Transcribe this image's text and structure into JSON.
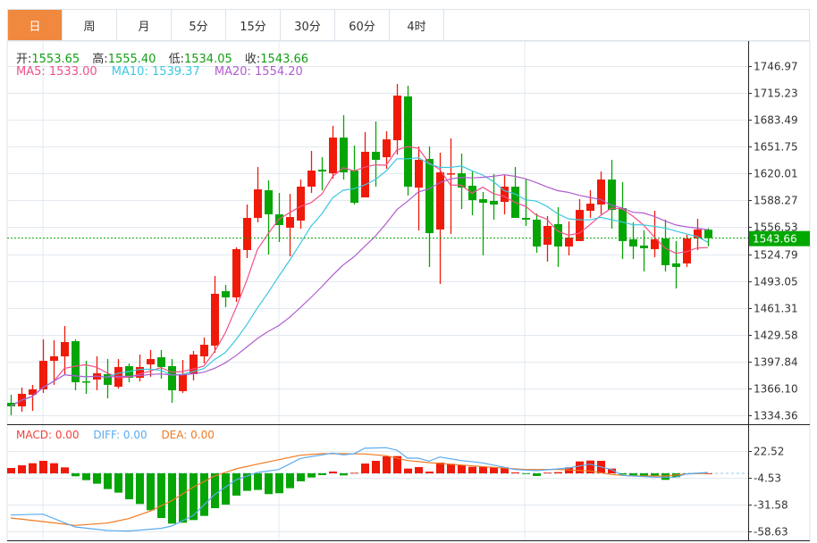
{
  "tabs": [
    "日",
    "周",
    "月",
    "5分",
    "15分",
    "30分",
    "60分",
    "4时",
    ""
  ],
  "active_tab": 0,
  "ohlc_info": {
    "open_label": "开:",
    "open": "1553.65",
    "high_label": "高:",
    "high": "1555.40",
    "low_label": "低:",
    "low": "1534.05",
    "close_label": "收:",
    "close": "1543.66"
  },
  "ma_info": {
    "ma5": "MA5: 1533.00",
    "ma10": "MA10: 1539.37",
    "ma20": "MA20: 1554.20"
  },
  "macd_info": {
    "macd": "MACD: 0.00",
    "diff": "DIFF: 0.00",
    "dea": "DEA: 0.00"
  },
  "colors": {
    "up": "#f01a0a",
    "down": "#06a506",
    "ma5": "#f0508a",
    "ma10": "#3cc8e0",
    "ma20": "#b05ccf",
    "diff": "#5aabf0",
    "dea": "#f07a22",
    "active_tab": "#f0883e",
    "last_price": "#00a800"
  },
  "chart_data": [
    {
      "type": "candlestick",
      "price_ticks": [
        "1746.97",
        "1715.23",
        "1683.49",
        "1651.75",
        "1620.01",
        "1588.27",
        "1556.53",
        "1524.79",
        "1493.05",
        "1461.31",
        "1429.58",
        "1397.84",
        "1366.10",
        "1334.36"
      ],
      "ylim": [
        1334.36,
        1746.97
      ],
      "grid": true,
      "last_price": "1543.66",
      "ohlc": [
        [
          1349.1,
          1358.6,
          1334.4,
          1344.9
        ],
        [
          1344.9,
          1367.1,
          1338.6,
          1359.7
        ],
        [
          1358.6,
          1370.3,
          1339.6,
          1365.0
        ],
        [
          1365.0,
          1424.0,
          1360.8,
          1398.7
        ],
        [
          1398.7,
          1423.0,
          1370.3,
          1404.0
        ],
        [
          1404.0,
          1439.9,
          1382.9,
          1420.9
        ],
        [
          1421.9,
          1424.0,
          1363.9,
          1373.4
        ],
        [
          1374.5,
          1398.7,
          1359.7,
          1373.4
        ],
        [
          1376.6,
          1404.0,
          1363.9,
          1384.0
        ],
        [
          1382.9,
          1400.8,
          1354.4,
          1370.3
        ],
        [
          1368.1,
          1400.8,
          1366.0,
          1391.4
        ],
        [
          1392.4,
          1395.6,
          1373.4,
          1378.7
        ],
        [
          1378.7,
          1406.1,
          1374.5,
          1391.4
        ],
        [
          1394.5,
          1411.4,
          1379.8,
          1400.8
        ],
        [
          1402.9,
          1411.4,
          1377.7,
          1391.4
        ],
        [
          1392.4,
          1400.8,
          1349.1,
          1363.9
        ],
        [
          1362.9,
          1399.8,
          1360.8,
          1382.9
        ],
        [
          1382.9,
          1410.3,
          1375.6,
          1406.1
        ],
        [
          1404.0,
          1426.2,
          1395.6,
          1417.7
        ],
        [
          1416.7,
          1499.0,
          1408.2,
          1477.9
        ],
        [
          1481.0,
          1488.4,
          1462.1,
          1473.7
        ],
        [
          1473.7,
          1532.8,
          1468.4,
          1530.7
        ],
        [
          1529.6,
          1583.4,
          1520.1,
          1567.6
        ],
        [
          1567.6,
          1627.7,
          1562.3,
          1601.3
        ],
        [
          1600.3,
          1611.9,
          1524.3,
          1571.8
        ],
        [
          1571.8,
          1597.1,
          1539.1,
          1559.1
        ],
        [
          1556.0,
          1596.0,
          1522.2,
          1568.6
        ],
        [
          1564.4,
          1612.9,
          1554.9,
          1604.5
        ],
        [
          1604.5,
          1646.7,
          1597.1,
          1623.5
        ],
        [
          1624.6,
          1639.3,
          1600.3,
          1622.4
        ],
        [
          1620.3,
          1676.3,
          1614.0,
          1662.5
        ],
        [
          1662.5,
          1688.9,
          1612.9,
          1621.4
        ],
        [
          1623.5,
          1653.0,
          1583.4,
          1585.5
        ],
        [
          1591.8,
          1668.9,
          1591.8,
          1645.7
        ],
        [
          1645.7,
          1681.5,
          1604.5,
          1636.2
        ],
        [
          1639.3,
          1669.9,
          1625.6,
          1660.4
        ],
        [
          1659.4,
          1725.9,
          1642.5,
          1712.1
        ],
        [
          1711.1,
          1723.8,
          1593.9,
          1604.5
        ],
        [
          1603.4,
          1652.0,
          1552.8,
          1636.2
        ],
        [
          1637.2,
          1652.0,
          1509.6,
          1549.6
        ],
        [
          1553.9,
          1644.6,
          1489.5,
          1621.4
        ],
        [
          1619.3,
          1661.5,
          1548.6,
          1620.3
        ],
        [
          1620.3,
          1643.5,
          1578.1,
          1603.4
        ],
        [
          1605.6,
          1622.4,
          1570.7,
          1588.6
        ],
        [
          1589.7,
          1598.2,
          1523.3,
          1585.5
        ],
        [
          1587.6,
          1619.3,
          1565.5,
          1583.4
        ],
        [
          1586.5,
          1618.2,
          1571.8,
          1604.5
        ],
        [
          1604.5,
          1627.7,
          1567.6,
          1567.6
        ],
        [
          1567.6,
          1612.9,
          1558.1,
          1565.5
        ],
        [
          1565.5,
          1572.8,
          1526.4,
          1533.8
        ],
        [
          1535.9,
          1569.7,
          1515.9,
          1558.1
        ],
        [
          1560.2,
          1580.2,
          1509.6,
          1533.8
        ],
        [
          1533.8,
          1563.4,
          1523.3,
          1544.4
        ],
        [
          1540.2,
          1589.7,
          1540.2,
          1577.0
        ],
        [
          1576.0,
          1600.3,
          1567.6,
          1584.4
        ],
        [
          1583.4,
          1622.4,
          1571.8,
          1612.9
        ],
        [
          1612.9,
          1636.2,
          1554.9,
          1577.0
        ],
        [
          1579.2,
          1609.8,
          1519.0,
          1540.2
        ],
        [
          1542.3,
          1562.3,
          1519.0,
          1533.8
        ],
        [
          1534.9,
          1552.8,
          1504.3,
          1531.7
        ],
        [
          1530.7,
          1576.0,
          1521.2,
          1542.3
        ],
        [
          1543.3,
          1565.5,
          1504.3,
          1511.7
        ],
        [
          1513.8,
          1540.2,
          1484.2,
          1509.6
        ],
        [
          1513.8,
          1547.6,
          1509.6,
          1543.3
        ],
        [
          1543.3,
          1566.5,
          1529.6,
          1553.9
        ],
        [
          1553.65,
          1555.4,
          1534.05,
          1543.66
        ]
      ],
      "ma_periods": [
        5,
        10,
        20
      ]
    },
    {
      "type": "bar+line",
      "macd_ticks": [
        "22.52",
        "-4.53",
        "-31.58",
        "-58.63"
      ],
      "ylim": [
        -58.63,
        22.52
      ],
      "histogram": [
        5.4,
        8.1,
        10.2,
        12.6,
        10.2,
        6.0,
        -3.0,
        -6.9,
        -10.5,
        -15.9,
        -19.5,
        -26.2,
        -31.0,
        -37.3,
        -45.1,
        -50.8,
        -49.9,
        -47.2,
        -43.0,
        -35.2,
        -31.6,
        -22.5,
        -17.7,
        -16.8,
        -21.0,
        -20.1,
        -15.0,
        -8.1,
        -4.2,
        -1.8,
        1.8,
        -2.1,
        0.5,
        9.9,
        12.6,
        17.1,
        17.4,
        4.8,
        6.3,
        1.8,
        10.8,
        9.6,
        8.1,
        6.6,
        6.6,
        6.0,
        6.0,
        0.9,
        -0.3,
        -2.7,
        0.6,
        1.2,
        6.0,
        12.0,
        12.9,
        12.6,
        4.8,
        -1.2,
        -2.1,
        -3.0,
        -3.0,
        -6.6,
        -3.9,
        -0.3,
        0.3,
        0.0
      ],
      "diff": [
        [
          0,
          -42.1
        ],
        [
          3,
          -41.2
        ],
        [
          6,
          -54.1
        ],
        [
          9,
          -57.7
        ],
        [
          11,
          -58.3
        ],
        [
          14,
          -55.6
        ],
        [
          15,
          -53.2
        ],
        [
          17,
          -42.7
        ],
        [
          19,
          -21.6
        ],
        [
          21,
          -6.6
        ],
        [
          23,
          0.9
        ],
        [
          25,
          3.9
        ],
        [
          27,
          15.0
        ],
        [
          30,
          20.4
        ],
        [
          31,
          18.6
        ],
        [
          32,
          19.8
        ],
        [
          33,
          25.3
        ],
        [
          35,
          25.9
        ],
        [
          36,
          23.4
        ],
        [
          37,
          15.3
        ],
        [
          38,
          15.3
        ],
        [
          39,
          12.3
        ],
        [
          40,
          16.5
        ],
        [
          42,
          12.9
        ],
        [
          44,
          10.5
        ],
        [
          47,
          3.9
        ],
        [
          49,
          2.7
        ],
        [
          52,
          5.4
        ],
        [
          54,
          9.3
        ],
        [
          56,
          3.9
        ],
        [
          57,
          -2.1
        ],
        [
          60,
          -3.9
        ],
        [
          62,
          -3.9
        ],
        [
          63,
          -0.6
        ],
        [
          65,
          0.9
        ]
      ],
      "dea": [
        [
          0,
          -45.1
        ],
        [
          3,
          -48.7
        ],
        [
          6,
          -52.6
        ],
        [
          9,
          -50.2
        ],
        [
          11,
          -45.7
        ],
        [
          13,
          -38.2
        ],
        [
          15,
          -27.7
        ],
        [
          17,
          -14.1
        ],
        [
          19,
          -2.7
        ],
        [
          21,
          4.5
        ],
        [
          23,
          9.3
        ],
        [
          25,
          13.8
        ],
        [
          27,
          18.3
        ],
        [
          29,
          19.8
        ],
        [
          31,
          19.8
        ],
        [
          33,
          19.5
        ],
        [
          35,
          17.7
        ],
        [
          37,
          12.9
        ],
        [
          39,
          10.8
        ],
        [
          42,
          8.4
        ],
        [
          45,
          6.0
        ],
        [
          48,
          3.9
        ],
        [
          51,
          3.9
        ],
        [
          54,
          2.4
        ],
        [
          56,
          -1.2
        ],
        [
          58,
          -2.7
        ],
        [
          61,
          -2.7
        ],
        [
          63,
          -0.6
        ],
        [
          65,
          0.0
        ]
      ]
    }
  ]
}
